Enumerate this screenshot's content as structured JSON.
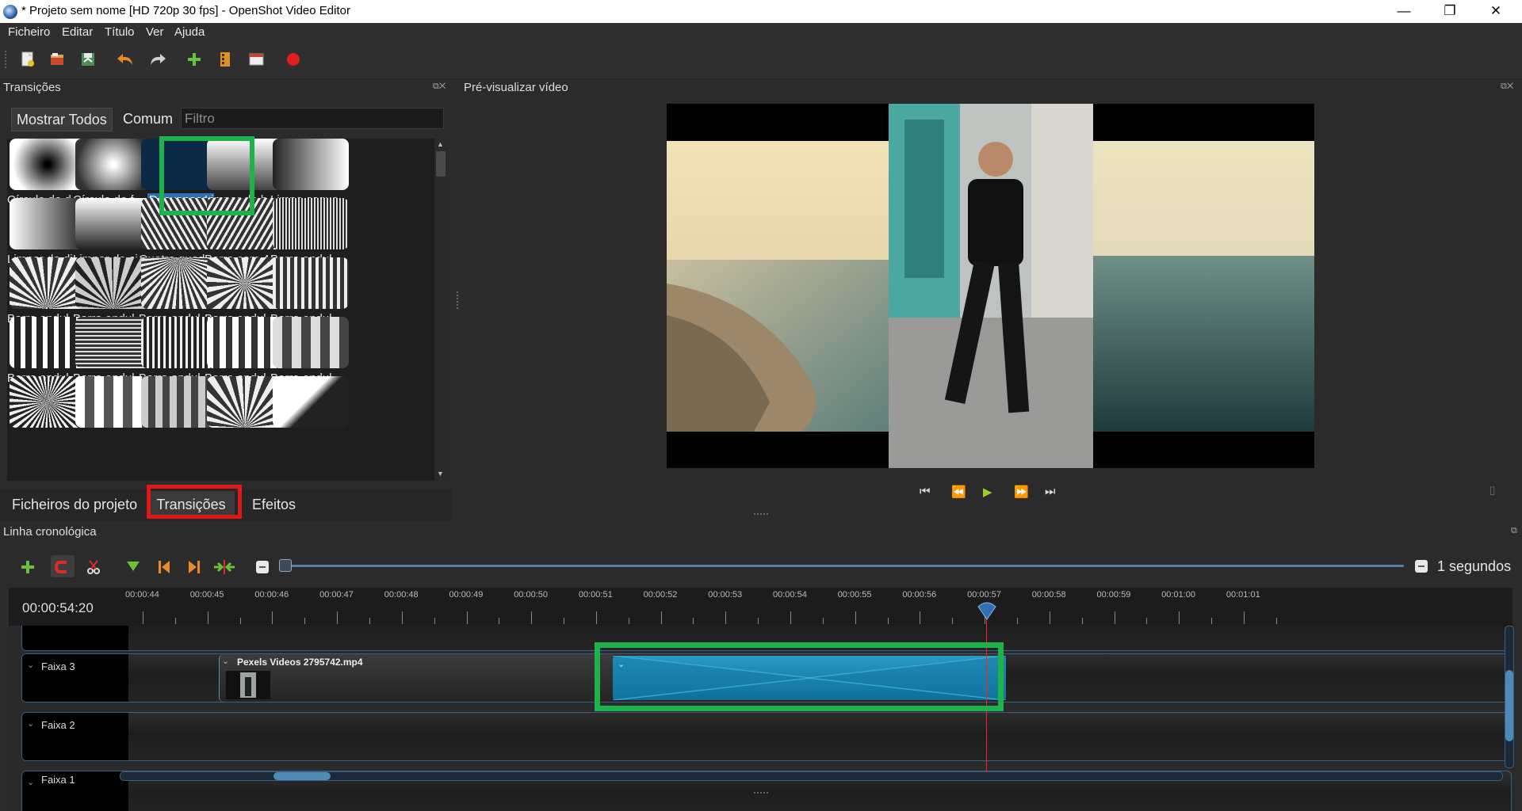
{
  "window": {
    "title": "* Projeto sem nome [HD 720p 30 fps] - OpenShot Video Editor",
    "minimize": "—",
    "maximize": "❐",
    "close": "✕"
  },
  "menu": [
    "Ficheiro",
    "Editar",
    "Título",
    "Ver",
    "Ajuda"
  ],
  "toolbar": {
    "icons": [
      "new-project-icon",
      "open-project-icon",
      "save-project-icon",
      "undo-icon",
      "redo-icon",
      "import-files-icon",
      "profile-icon",
      "fullscreen-icon",
      "record-icon"
    ]
  },
  "transitions_panel": {
    "title": "Transições",
    "filter_all": "Mostrar Todos",
    "filter_common": "Comum",
    "filter_placeholder": "Filtro",
    "items": [
      "Círculo de d...",
      "Círculo de f...",
      "Desvanecer",
      "Limpar de b...",
      "Limpe esque...",
      "Limpar da di...",
      "Limpar de ci...",
      "Quatro quad...",
      "Barra com 4 ...",
      "Barra ondul...",
      "Barra ondul...",
      "Barra ondul...",
      "Barra ondul...",
      "Barra ondul...",
      "Barra ondul...",
      "Barra ondul...",
      "Barra ondul...",
      "Barra ondul...",
      "Barra ondul...",
      "Barra ondul...",
      "",
      "",
      "",
      "",
      ""
    ],
    "selected_item": "Desvanecer"
  },
  "bottom_tabs": [
    "Ficheiros do projeto",
    "Transições",
    "Efeitos"
  ],
  "active_tab": "Transições",
  "preview": {
    "title": "Pré-visualizar vídeo"
  },
  "timeline": {
    "title": "Linha cronológica",
    "current_time": "00:00:54:20",
    "zoom_label": "1 segundos",
    "ruler_labels": [
      "00:00:44",
      "00:00:45",
      "00:00:46",
      "00:00:47",
      "00:00:48",
      "00:00:49",
      "00:00:50",
      "00:00:51",
      "00:00:52",
      "00:00:53",
      "00:00:54",
      "00:00:55",
      "00:00:56",
      "00:00:57",
      "00:00:58",
      "00:00:59",
      "00:01:00",
      "00:01:01"
    ],
    "tracks": [
      "Faixa 3",
      "Faixa 2",
      "Faixa 1"
    ],
    "clip_name": "Pexels Videos 2795742.mp4"
  },
  "colors": {
    "highlight_green": "#1db24a",
    "highlight_red": "#e01818",
    "transition_blue": "#1a86b0",
    "playhead": "#ff2020"
  }
}
